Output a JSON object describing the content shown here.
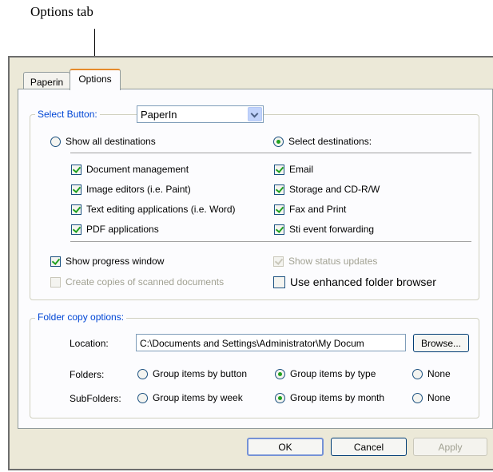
{
  "callout": "Options tab",
  "tabs": [
    "Paperin",
    "Options"
  ],
  "select_button": {
    "legend": "Select Button:",
    "value": "PaperIn"
  },
  "destinations": {
    "show_all": {
      "label": "Show all destinations",
      "selected": false
    },
    "select_dest": {
      "label": "Select destinations:",
      "selected": true
    },
    "left": [
      {
        "label": "Document management",
        "checked": true
      },
      {
        "label": "Image editors (i.e. Paint)",
        "checked": true
      },
      {
        "label": "Text editing applications (i.e. Word)",
        "checked": true
      },
      {
        "label": "PDF applications",
        "checked": true
      }
    ],
    "right": [
      {
        "label": "Email",
        "checked": true
      },
      {
        "label": "Storage and CD-R/W",
        "checked": true
      },
      {
        "label": "Fax and Print",
        "checked": true
      },
      {
        "label": "Sti event forwarding",
        "checked": true
      }
    ]
  },
  "options": {
    "show_progress": {
      "label": "Show progress window",
      "checked": true
    },
    "show_status": {
      "label": "Show status updates",
      "checked": true,
      "disabled": true
    },
    "create_copies": {
      "label": "Create copies of scanned documents",
      "checked": false,
      "disabled": true
    },
    "enhanced_browser": {
      "label": "Use enhanced folder browser",
      "checked": false
    }
  },
  "folder_copy": {
    "legend": "Folder copy options:",
    "location_label": "Location:",
    "location_value": "C:\\Documents and Settings\\Administrator\\My Docum",
    "browse": "Browse...",
    "folders_label": "Folders:",
    "folders": [
      {
        "label": "Group items by button",
        "selected": false
      },
      {
        "label": "Group items by type",
        "selected": true
      },
      {
        "label": "None",
        "selected": false
      }
    ],
    "subfolders_label": "SubFolders:",
    "subfolders": [
      {
        "label": "Group items by week",
        "selected": false
      },
      {
        "label": "Group items by month",
        "selected": true
      },
      {
        "label": "None",
        "selected": false
      }
    ]
  },
  "buttons": {
    "ok": "OK",
    "cancel": "Cancel",
    "apply": "Apply"
  }
}
